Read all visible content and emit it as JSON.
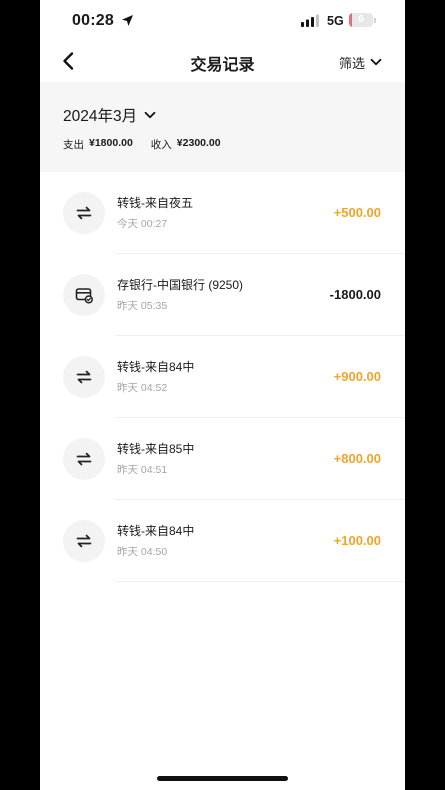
{
  "status_bar": {
    "time": "00:28",
    "network": "5G",
    "battery_level": "6",
    "battery_percent": 0.06,
    "colors": {
      "battery_low": "#e36d7a"
    }
  },
  "nav": {
    "title": "交易记录",
    "filter_label": "筛选"
  },
  "summary": {
    "month": "2024年3月",
    "expense_label": "支出",
    "expense_value": "¥1800.00",
    "income_label": "收入",
    "income_value": "¥2300.00"
  },
  "colors": {
    "income_amount": "#f0a52a",
    "expense_amount": "#1a1a1a",
    "summary_bg": "#f6f6f6"
  },
  "transactions": [
    {
      "icon": "transfer-icon",
      "title": "转钱-来自夜五",
      "time": "今天 00:27",
      "amount": "+500.00",
      "kind": "income"
    },
    {
      "icon": "bank-card-icon",
      "title": "存银行-中国银行 (9250)",
      "time": "昨天 05:35",
      "amount": "-1800.00",
      "kind": "expense"
    },
    {
      "icon": "transfer-icon",
      "title": "转钱-来自84中",
      "time": "昨天 04:52",
      "amount": "+900.00",
      "kind": "income"
    },
    {
      "icon": "transfer-icon",
      "title": "转钱-来自85中",
      "time": "昨天 04:51",
      "amount": "+800.00",
      "kind": "income"
    },
    {
      "icon": "transfer-icon",
      "title": "转钱-来自84中",
      "time": "昨天 04:50",
      "amount": "+100.00",
      "kind": "income"
    }
  ]
}
